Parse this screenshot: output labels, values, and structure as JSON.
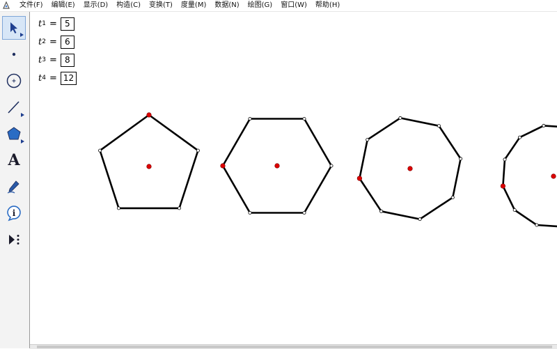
{
  "menu": [
    "文件(F)",
    "编辑(E)",
    "显示(D)",
    "构造(C)",
    "变换(T)",
    "度量(M)",
    "数据(N)",
    "绘图(G)",
    "窗口(W)",
    "帮助(H)"
  ],
  "toolbox": {
    "tools": [
      {
        "name": "arrow-tool",
        "selected": true
      },
      {
        "name": "point-tool"
      },
      {
        "name": "compass-tool"
      },
      {
        "name": "straightedge-tool"
      },
      {
        "name": "polygon-tool"
      },
      {
        "name": "text-tool",
        "glyph": "A"
      },
      {
        "name": "marker-tool"
      },
      {
        "name": "information-tool",
        "glyph": "i"
      },
      {
        "name": "custom-tool"
      }
    ]
  },
  "parameters": [
    {
      "name": "t",
      "subscript": "1",
      "value": "5"
    },
    {
      "name": "t",
      "subscript": "2",
      "value": "6"
    },
    {
      "name": "t",
      "subscript": "3",
      "value": "8"
    },
    {
      "name": "t",
      "subscript": "4",
      "value": "12"
    }
  ],
  "parameter_equals": "=",
  "polygons": [
    {
      "sides": 5
    },
    {
      "sides": 6
    },
    {
      "sides": 8
    },
    {
      "sides": 12
    }
  ],
  "colors": {
    "center_point": "#dd0000",
    "edge": "#000000",
    "vertex_fill": "#ffffff"
  }
}
